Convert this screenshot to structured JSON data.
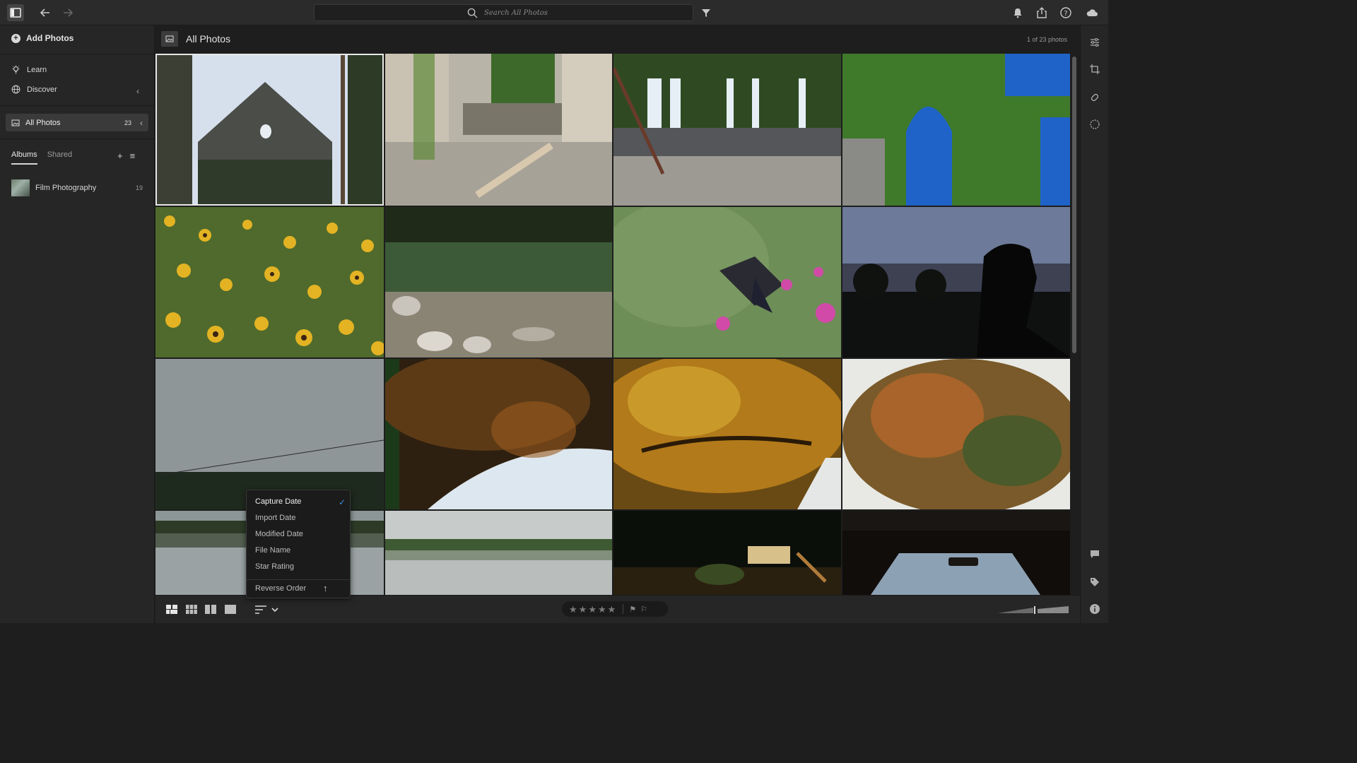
{
  "topbar": {
    "search_placeholder": "Search All Photos"
  },
  "sidebar": {
    "add_photos_label": "Add Photos",
    "learn_label": "Learn",
    "discover_label": "Discover",
    "all_photos_label": "All Photos",
    "all_photos_count": "23",
    "tabs": [
      "Albums",
      "Shared"
    ],
    "albums": [
      {
        "name": "Film Photography",
        "count": "19"
      }
    ]
  },
  "main": {
    "title": "All Photos",
    "photo_count_text": "1 of 23 photos"
  },
  "sort_menu": {
    "items": [
      "Capture Date",
      "Import Date",
      "Modified Date",
      "File Name",
      "Star Rating"
    ],
    "selected": "Capture Date",
    "reverse_label": "Reverse Order"
  },
  "colors": {
    "accent": "#3c8fe0",
    "background": "#1e1e1e",
    "panel": "#262626"
  }
}
